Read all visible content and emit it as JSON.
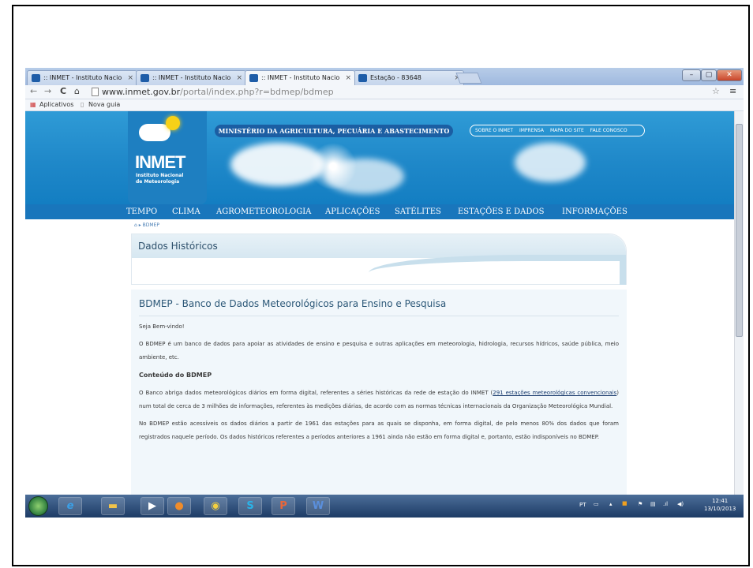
{
  "browser": {
    "tabs": [
      {
        "label": ":: INMET - Instituto Nacio",
        "active": false
      },
      {
        "label": ":: INMET - Instituto Nacio",
        "active": false
      },
      {
        "label": ":: INMET - Instituto Nacio",
        "active": true
      },
      {
        "label": "Estação - 83648",
        "active": false
      }
    ],
    "url_domain": "www.inmet.gov.br",
    "url_path": "/portal/index.php?r=bdmep/bdmep",
    "bookmarks": {
      "apps": "Aplicativos",
      "new_tab": "Nova guia"
    },
    "window_controls": {
      "minimize": "–",
      "maximize": "▢",
      "close": "✕"
    }
  },
  "site": {
    "logo": {
      "name": "INMET",
      "sub1": "Instituto Nacional",
      "sub2": "de Meteorologia"
    },
    "ministry": "MINISTÉRIO DA AGRICULTURA, PECUÁRIA E ABASTECIMENTO",
    "top_links": [
      "SOBRE O INMET",
      "IMPRENSA",
      "MAPA DO SITE",
      "FALE CONOSCO"
    ],
    "nav": [
      "TEMPO",
      "CLIMA",
      "AGROMETEOROLOGIA",
      "APLICAÇÕES",
      "SATÉLITES",
      "ESTAÇÕES E DADOS",
      "INFORMAÇÕES"
    ],
    "breadcrumb": "BDMEP",
    "section_title": "Dados Históricos",
    "content": {
      "title": "BDMEP - Banco de Dados Meteorológicos para Ensino e Pesquisa",
      "welcome": "Seja Bem-vindo!",
      "intro": "O BDMEP é um banco de dados para apoiar as atividades de ensino e pesquisa e outras aplicações em meteorologia, hidrologia, recursos hídricos, saúde pública, meio ambiente, etc.",
      "heading": "Conteúdo do BDMEP",
      "p1_before": "O Banco abriga dados meteorológicos diários em forma digital, referentes a séries históricas da rede de estação do INMET (",
      "p1_link": "291 estações meteorológicas convencionais",
      "p1_after": ") num total de cerca de 3 milhões de informações, referentes às medições diárias, de acordo com as normas técnicas internacionais da Organização Meteorológica Mundial.",
      "p2": "No BDMEP estão acessíveis os dados diários a partir de 1961 das estações para as quais se disponha, em forma digital, de pelo menos 80% dos dados que foram registrados naquele período. Os dados históricos referentes a períodos anteriores a 1961 ainda não estão em forma digital e, portanto, estão indisponíveis no BDMEP."
    }
  },
  "taskbar": {
    "lang": "PT",
    "time": "12:41",
    "date": "13/10/2013"
  },
  "colors": {
    "banner": "#1f88c9",
    "nav": "#1976bc",
    "ministry": "#1b5ea3",
    "content_bg": "#f1f7fb"
  }
}
